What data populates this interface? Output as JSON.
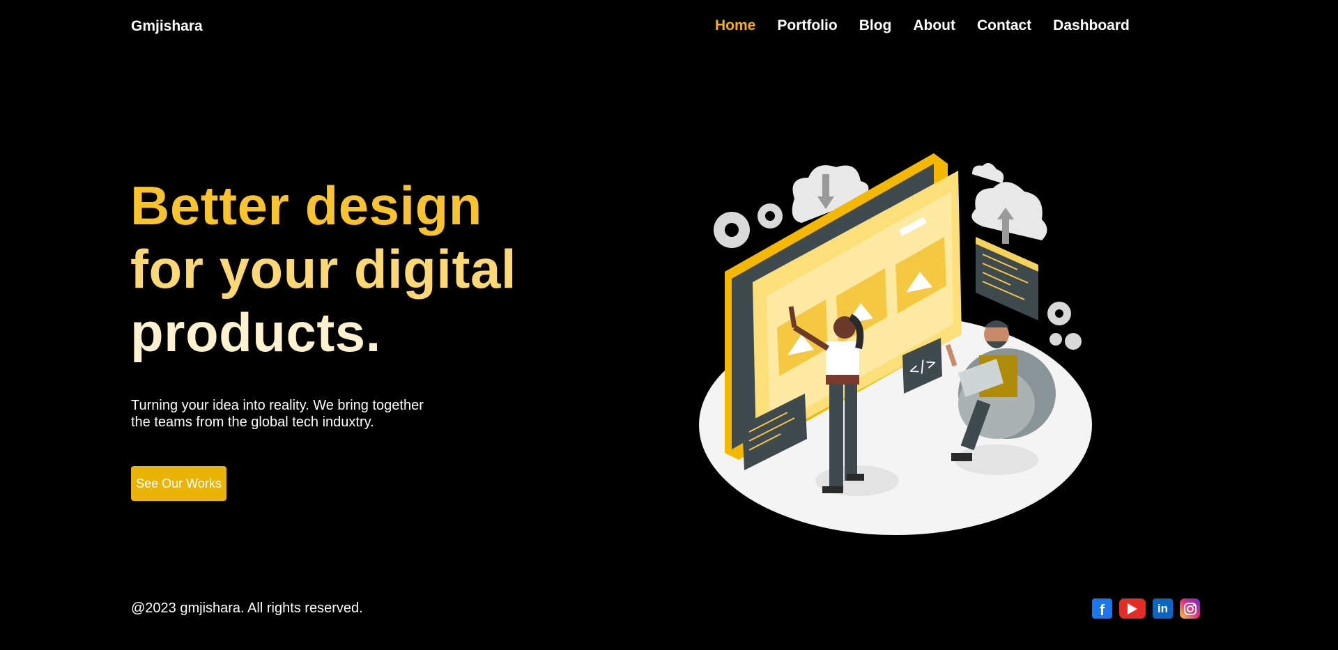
{
  "header": {
    "brand": "Gmjishara",
    "nav": [
      {
        "label": "Home",
        "active": true
      },
      {
        "label": "Portfolio",
        "active": false
      },
      {
        "label": "Blog",
        "active": false
      },
      {
        "label": "About",
        "active": false
      },
      {
        "label": "Contact",
        "active": false
      },
      {
        "label": "Dashboard",
        "active": false
      }
    ]
  },
  "hero": {
    "title_line1": "Better design",
    "title_line2": "for your digital",
    "title_line3": "products.",
    "subtitle_line1": "Turning your idea into reality. We bring together",
    "subtitle_line2": "the teams from the global tech induxtry.",
    "cta_label": "See Our Works"
  },
  "footer": {
    "copyright": "@2023 gmjishara. All rights reserved.",
    "social_icons": [
      "facebook-icon",
      "youtube-icon",
      "linkedin-icon",
      "instagram-icon"
    ]
  },
  "colors": {
    "accent": "#f5b40a",
    "button": "#e9b308",
    "background": "#000000"
  }
}
